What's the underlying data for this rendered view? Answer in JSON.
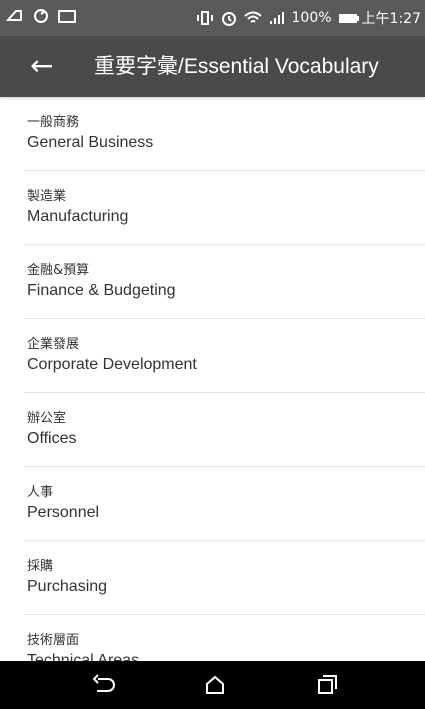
{
  "status_bar": {
    "battery_text": "100%",
    "time": "上午1:27"
  },
  "appbar": {
    "back_icon": "arrow-left-icon",
    "title": "重要字彙/Essential Vocabulary"
  },
  "list": {
    "items": [
      {
        "zh": "一般商務",
        "en": "General Business"
      },
      {
        "zh": "製造業",
        "en": "Manufacturing"
      },
      {
        "zh": "金融&預算",
        "en": "Finance & Budgeting"
      },
      {
        "zh": "企業發展",
        "en": "Corporate Development"
      },
      {
        "zh": "辦公室",
        "en": "Offices"
      },
      {
        "zh": "人事",
        "en": "Personnel"
      },
      {
        "zh": "採購",
        "en": "Purchasing"
      },
      {
        "zh": "技術層面",
        "en": "Technical Areas"
      }
    ]
  },
  "navbar": {
    "back_icon": "nav-back-icon",
    "home_icon": "nav-home-icon",
    "recents_icon": "nav-recents-icon"
  }
}
